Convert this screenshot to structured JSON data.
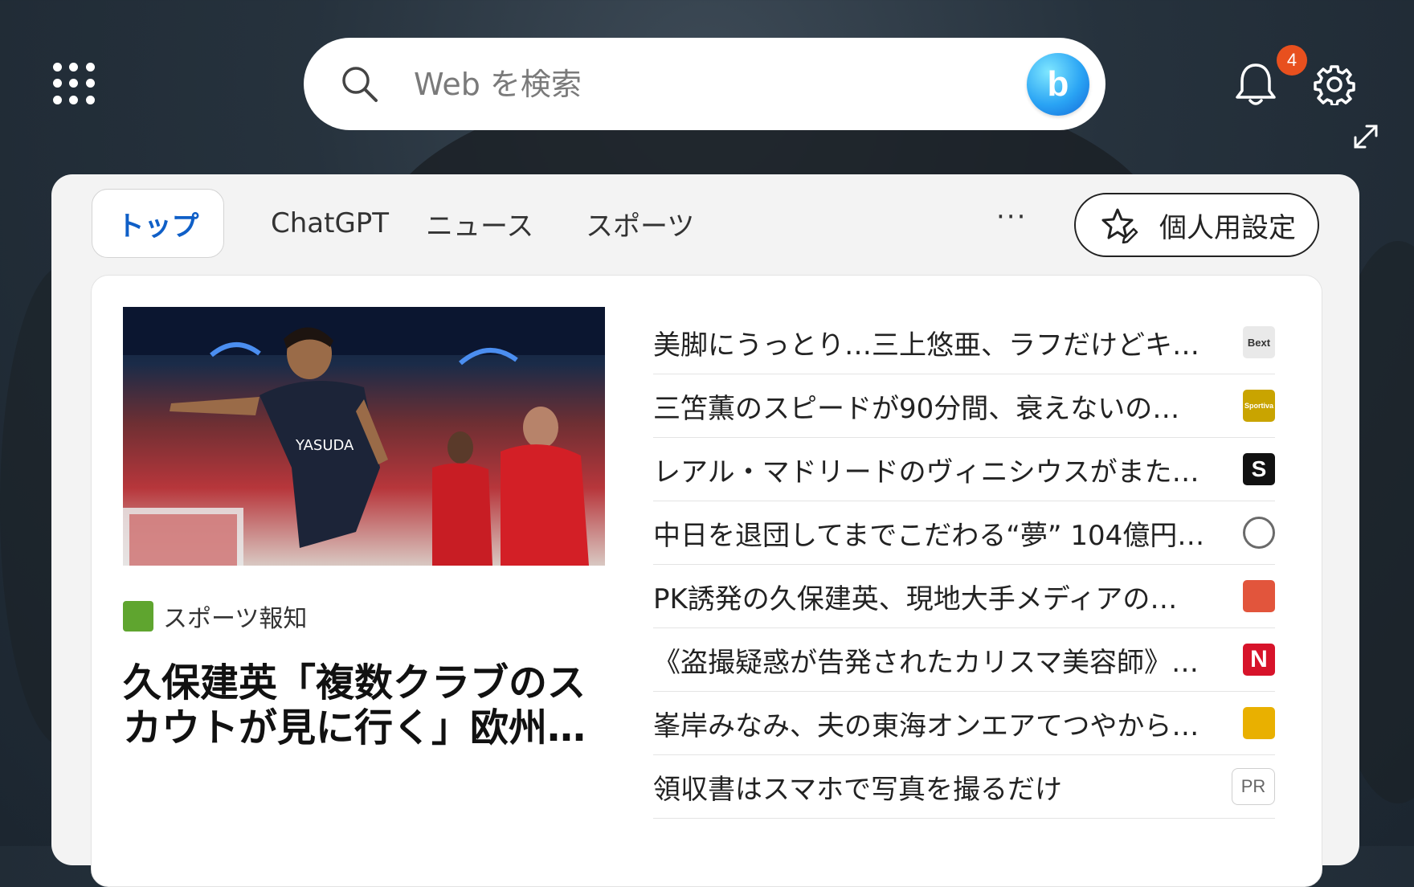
{
  "search": {
    "placeholder": "Web を検索"
  },
  "notifications": {
    "count": "4"
  },
  "tabs": [
    {
      "label": "トップ"
    },
    {
      "label": "ChatGPT"
    },
    {
      "label": "ニュース"
    },
    {
      "label": "スポーツ"
    }
  ],
  "more_label": "···",
  "personalize_label": "個人用設定",
  "hero": {
    "source": "スポーツ報知",
    "headline": "久保建英「複数クラブのスカウトが見に行く」欧州…",
    "image_jersey": "YASUDA"
  },
  "news": [
    {
      "title": "美脚にうっとり…三上悠亜、ラフだけどキ…",
      "logo_color": "#e9e9e9",
      "logo_text": "Bext"
    },
    {
      "title": "三笘薫のスピードが90分間、衰えないの…",
      "logo_color": "#c9a400",
      "logo_text": "Sportiva"
    },
    {
      "title": "レアル・マドリードのヴィニシウスがまた…",
      "logo_color": "#111111",
      "logo_text": "S"
    },
    {
      "title": "中日を退団してまでこだわる“夢” 104億円…",
      "logo_color": "#6a6a6a",
      "logo_text": ""
    },
    {
      "title": "PK誘発の久保建英、現地大手メディアの…",
      "logo_color": "#e2553c",
      "logo_text": ""
    },
    {
      "title": "《盗撮疑惑が告発されたカリスマ美容師》…",
      "logo_color": "#d7132a",
      "logo_text": "N"
    },
    {
      "title": "峯岸みなみ、夫の東海オンエアてつやから…",
      "logo_color": "#e9b000",
      "logo_text": ""
    },
    {
      "title": "領収書はスマホで写真を撮るだけ",
      "logo_color": "",
      "logo_text": "PR"
    }
  ]
}
